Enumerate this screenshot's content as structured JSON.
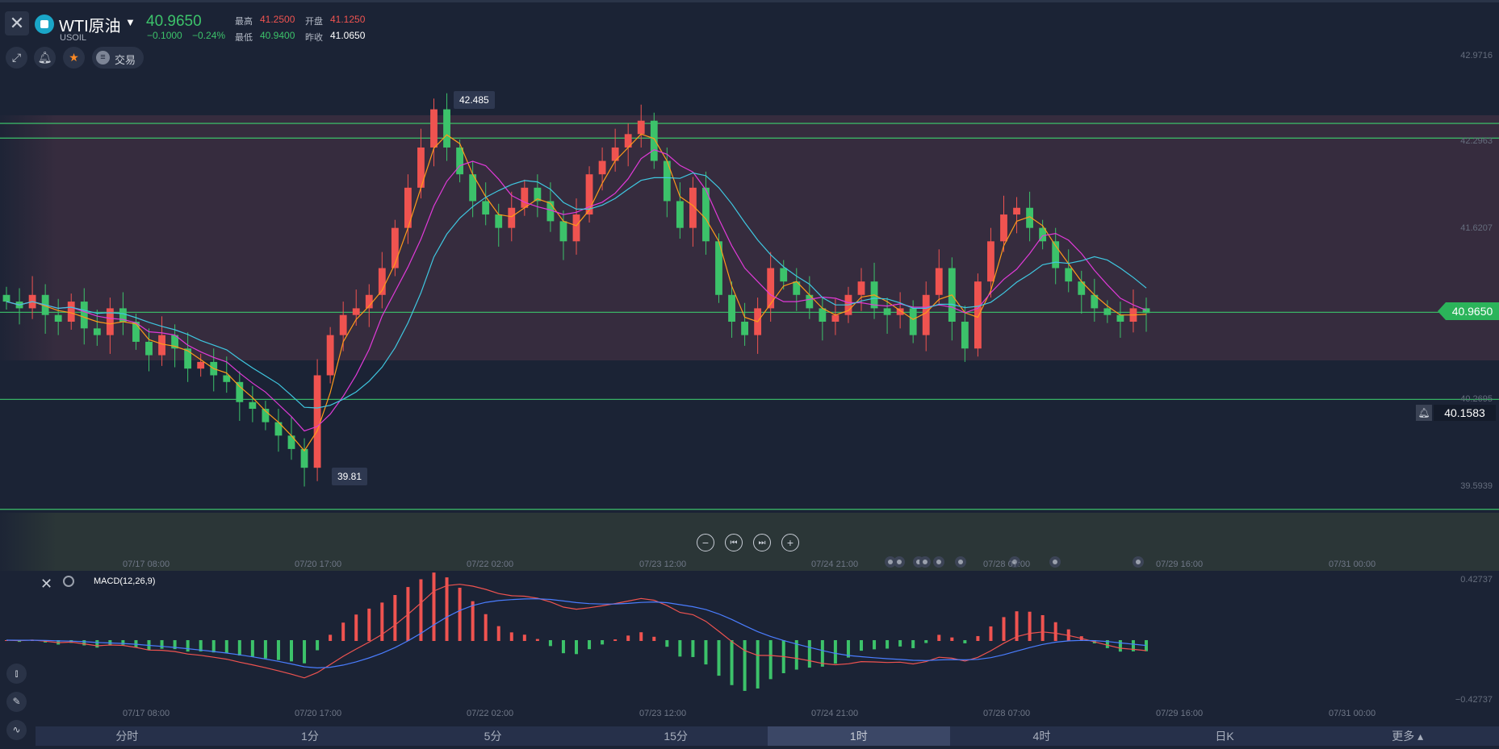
{
  "header": {
    "symbol_name": "WTI原油",
    "symbol_code": "USOIL",
    "last_price": "40.9650",
    "change": "−0.1000",
    "change_pct": "−0.24%",
    "high_label": "最高",
    "high": "41.2500",
    "open_label": "开盘",
    "open": "41.1250",
    "low_label": "最低",
    "low": "40.9400",
    "prev_close_label": "昨收",
    "prev_close": "41.0650"
  },
  "toolbar": {
    "trade_label": "交易"
  },
  "main_axis": {
    "ticks": [
      "42.9716",
      "42.2963",
      "41.6207",
      "40.2695",
      "39.5939"
    ]
  },
  "price_badge": "40.9650",
  "alert_price": "40.1583",
  "annotations": {
    "high_callout": "42.485",
    "low_callout": "39.81"
  },
  "time_axis": [
    "07/17 08:00",
    "07/20 17:00",
    "07/22 02:00",
    "07/23 12:00",
    "07/24 21:00",
    "07/28 07:00",
    "07/29 16:00",
    "07/31 00:00"
  ],
  "macd": {
    "label": "MACD(12,26,9)",
    "top": "0.42737",
    "bottom": "−0.42737"
  },
  "timeframes": [
    "分时",
    "1分",
    "5分",
    "15分",
    "1时",
    "4时",
    "日K",
    "更多 ▴"
  ],
  "active_timeframe": "1时",
  "colors": {
    "up": "#3cc26a",
    "down": "#ef5350",
    "line_white": "#ffffff",
    "ma_orange": "#ff9a1a",
    "ma_magenta": "#e03ad8",
    "ma_cyan": "#3fc7e0"
  },
  "chart_data": {
    "type": "candlestick",
    "symbol": "USOIL",
    "interval": "1时",
    "y_range": [
      39.45,
      43.0
    ],
    "close_series": [
      41.05,
      41.0,
      41.1,
      40.95,
      40.9,
      41.05,
      40.85,
      40.8,
      41.0,
      40.9,
      40.75,
      40.65,
      40.8,
      40.7,
      40.55,
      40.6,
      40.5,
      40.45,
      40.3,
      40.25,
      40.15,
      40.05,
      39.95,
      39.81,
      40.5,
      40.8,
      40.95,
      41.0,
      41.1,
      41.3,
      41.6,
      41.9,
      42.2,
      42.485,
      42.2,
      42.0,
      41.8,
      41.7,
      41.6,
      41.75,
      41.9,
      41.8,
      41.65,
      41.5,
      41.7,
      42.0,
      42.1,
      42.2,
      42.3,
      42.4,
      42.1,
      41.8,
      41.6,
      41.9,
      41.5,
      41.1,
      40.9,
      40.8,
      41.0,
      41.3,
      41.2,
      41.1,
      41.0,
      40.9,
      40.95,
      41.1,
      41.2,
      41.0,
      40.95,
      41.0,
      40.8,
      41.1,
      41.3,
      40.9,
      40.7,
      41.2,
      41.5,
      41.7,
      41.75,
      41.6,
      41.5,
      41.3,
      41.2,
      41.1,
      41.0,
      40.95,
      40.9,
      41.0,
      40.965
    ],
    "annotations": {
      "high": 42.485,
      "low": 39.81
    },
    "horizontal_levels": [
      42.38,
      42.27,
      40.97,
      40.32,
      39.5
    ],
    "macd_range": [
      -0.42737,
      0.42737
    ]
  }
}
